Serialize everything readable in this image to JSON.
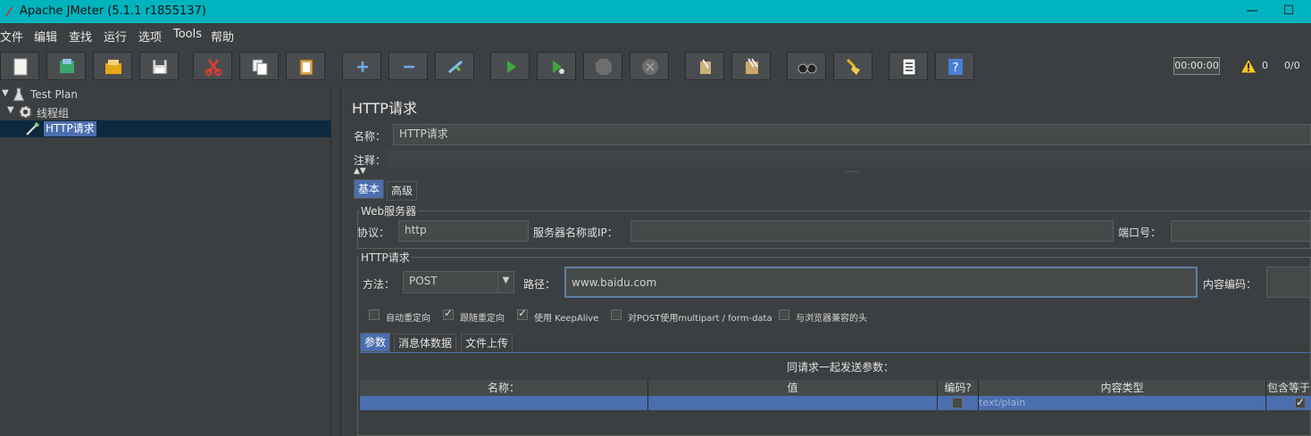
{
  "window": {
    "title": "Apache JMeter (5.1.1 r1855137)",
    "minimize": "—",
    "maximize": "☐"
  },
  "menu": [
    "文件",
    "编辑",
    "查找",
    "运行",
    "选项",
    "Tools",
    "帮助"
  ],
  "toolbar": {
    "buttons": [
      "new-icon",
      "templates-icon",
      "open-icon",
      "save-icon",
      "cut-icon",
      "copy-icon",
      "paste-icon",
      "expand-icon",
      "collapse-icon",
      "toggle-icon",
      "start-icon",
      "start-no-pause-icon",
      "stop-icon",
      "shutdown-icon",
      "clear-icon",
      "clear-all-icon",
      "search-icon",
      "reset-search-icon",
      "function-helper-icon",
      "help-icon"
    ],
    "timer": "00:00:00",
    "warn_count": "0",
    "thread_ratio": "0/0"
  },
  "tree": {
    "items": [
      {
        "label": "Test Plan"
      },
      {
        "label": "线程组"
      },
      {
        "label": "HTTP请求"
      }
    ]
  },
  "panel": {
    "title": "HTTP请求",
    "name_label": "名称：",
    "name_value": "HTTP请求",
    "comment_label": "注释：",
    "tabs": [
      "基本",
      "高级"
    ],
    "web_server": {
      "title": "Web服务器",
      "protocol_label": "协议：",
      "protocol_value": "http",
      "server_label": "服务器名称或IP：",
      "server_value": "",
      "port_label": "端口号："
    },
    "http_request": {
      "title": "HTTP请求",
      "method_label": "方法：",
      "method_value": "POST",
      "path_label": "路径：",
      "path_value": "www.baidu.com",
      "encoding_label": "内容编码："
    },
    "options": [
      {
        "label": "自动重定向",
        "checked": false
      },
      {
        "label": "跟随重定向",
        "checked": true
      },
      {
        "label": "使用 KeepAlive",
        "checked": true
      },
      {
        "label": "对POST使用multipart / form-data",
        "checked": false
      },
      {
        "label": "与浏览器兼容的头",
        "checked": false
      }
    ],
    "subtabs": [
      "参数",
      "消息体数据",
      "文件上传"
    ],
    "params_caption": "同请求一起发送参数：",
    "table": {
      "headers": [
        "名称：",
        "值",
        "编码?",
        "内容类型",
        "包含等于"
      ],
      "rows": [
        {
          "name": "",
          "value": "",
          "encode": false,
          "content_type": "text/plain",
          "include_equals": true
        }
      ]
    }
  }
}
